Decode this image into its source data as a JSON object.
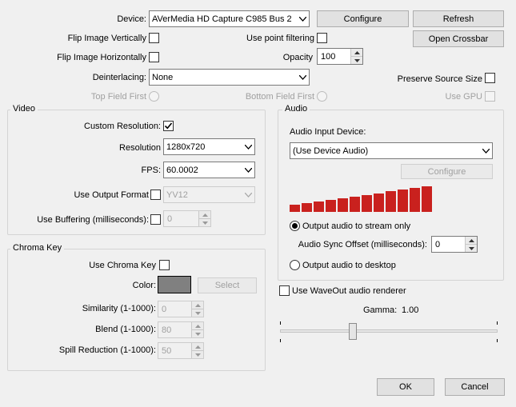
{
  "device": {
    "label": "Device:",
    "value": "AVerMedia HD Capture C985 Bus 2",
    "configure_label": "Configure",
    "refresh_label": "Refresh"
  },
  "flip_vertical": {
    "label": "Flip Image Vertically",
    "checked": false
  },
  "point_filtering": {
    "label": "Use point filtering",
    "checked": false
  },
  "open_crossbar_label": "Open Crossbar",
  "flip_horizontal": {
    "label": "Flip Image Horizontally",
    "checked": false
  },
  "opacity": {
    "label": "Opacity",
    "value": "100"
  },
  "deinterlacing": {
    "label": "Deinterlacing:",
    "value": "None"
  },
  "preserve_source_size": {
    "label": "Preserve Source Size",
    "checked": false
  },
  "top_field_first": {
    "label": "Top Field First"
  },
  "bottom_field_first": {
    "label": "Bottom Field First"
  },
  "use_gpu": {
    "label": "Use GPU"
  },
  "video": {
    "title": "Video",
    "custom_resolution": {
      "label": "Custom Resolution:",
      "checked": true
    },
    "resolution": {
      "label": "Resolution",
      "value": "1280x720"
    },
    "fps": {
      "label": "FPS:",
      "value": "60.0002"
    },
    "use_output_format": {
      "label": "Use Output Format",
      "value": "YV12"
    },
    "use_buffering": {
      "label": "Use Buffering (milliseconds):",
      "value": "0"
    }
  },
  "audio": {
    "title": "Audio",
    "input_device_label": "Audio Input Device:",
    "input_device_value": "(Use Device Audio)",
    "configure_label": "Configure",
    "meter_levels": [
      0.27,
      0.33,
      0.4,
      0.47,
      0.53,
      0.6,
      0.67,
      0.73,
      0.8,
      0.87,
      0.93,
      1.0
    ],
    "meter_color": "#c9211e",
    "output_to_stream": {
      "label": "Output audio to stream only",
      "selected": true
    },
    "sync_offset": {
      "label": "Audio Sync Offset (milliseconds):",
      "value": "0"
    },
    "output_to_desktop": {
      "label": "Output audio to desktop",
      "selected": false
    }
  },
  "chroma": {
    "title": "Chroma Key",
    "use_chroma_key": {
      "label": "Use Chroma Key",
      "checked": false
    },
    "color_label": "Color:",
    "color_value": "#808080",
    "select_label": "Select",
    "similarity": {
      "label": "Similarity (1-1000):",
      "value": "0"
    },
    "blend": {
      "label": "Blend (1-1000):",
      "value": "80"
    },
    "spill": {
      "label": "Spill Reduction (1-1000):",
      "value": "50"
    }
  },
  "waveout": {
    "label": "Use WaveOut audio renderer",
    "checked": false
  },
  "gamma": {
    "label": "Gamma:",
    "value": "1.00",
    "level": 0.33
  },
  "ok_label": "OK",
  "cancel_label": "Cancel"
}
